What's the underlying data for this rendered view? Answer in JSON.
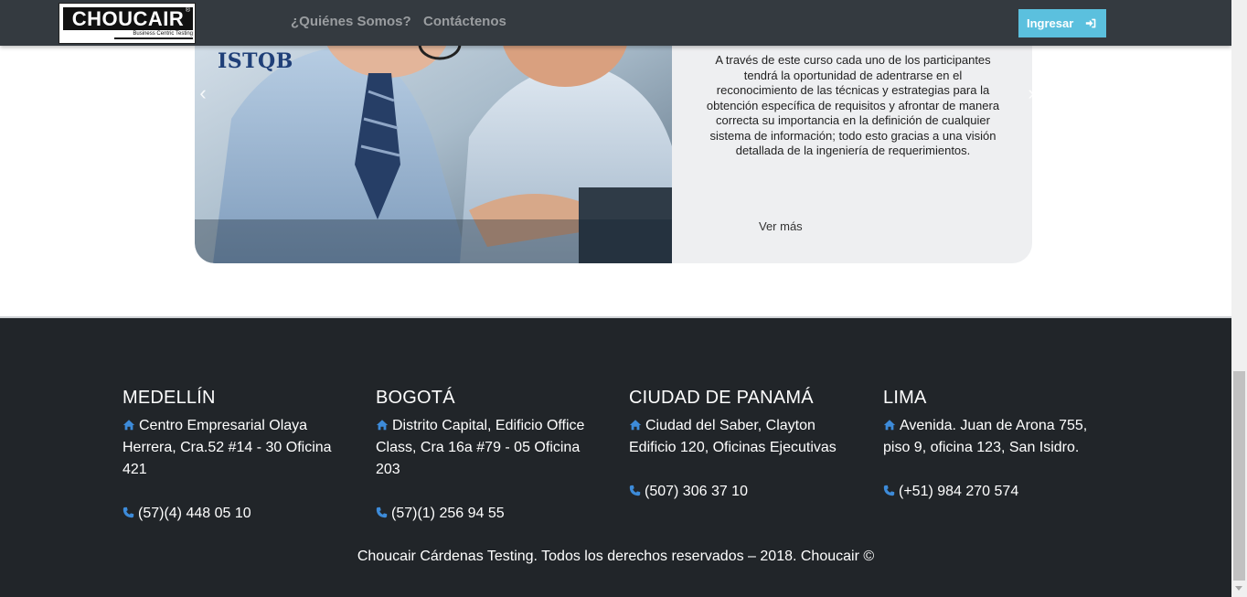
{
  "navbar": {
    "logo_text": "CHOUCAIR",
    "logo_tagline": "Business Centric Testing",
    "links": [
      "¿Quiénes Somos?",
      "Contáctenos"
    ],
    "login_label": "Ingresar"
  },
  "carousel": {
    "badge_text": "ISTQB",
    "description": "A través de este curso cada uno de los participantes tendrá la oportunidad de adentrarse en el reconocimiento de las técnicas y estrategias para la obtención específica de requisitos y afrontar de manera correcta su importancia en la definición de cualquier sistema de información; todo esto gracias a una visión detallada de la ingeniería de requerimientos.",
    "see_more_label": "Ver más"
  },
  "footer": {
    "offices": [
      {
        "city": "MEDELLÍN",
        "address": "Centro Empresarial Olaya Herrera, Cra.52 #14 - 30 Oficina 421",
        "phone": "(57)(4) 448 05 10"
      },
      {
        "city": "BOGOTÁ",
        "address": "Distrito Capital, Edificio Office Class, Cra 16a #79 - 05 Oficina 203",
        "phone": "(57)(1) 256 94 55"
      },
      {
        "city": "CIUDAD DE PANAMÁ",
        "address": "Ciudad del Saber, Clayton Edificio 120, Oficinas Ejecutivas",
        "phone": "(507) 306 37 10"
      },
      {
        "city": "LIMA",
        "address": "Avenida. Juan de Arona 755, piso 9, oficina 123, San Isidro.",
        "phone": "(+51) 984 270 574"
      }
    ],
    "copyright": "Choucair Cárdenas Testing. Todos los derechos reservados – 2018. Choucair ©"
  },
  "colors": {
    "navbar_bg": "#343a40",
    "login_button": "#5bc0de",
    "footer_bg": "#212529",
    "icon_blue": "#3d8bd9"
  },
  "icons": {
    "address": "home-icon",
    "phone": "phone-icon",
    "login": "sign-in-icon"
  }
}
